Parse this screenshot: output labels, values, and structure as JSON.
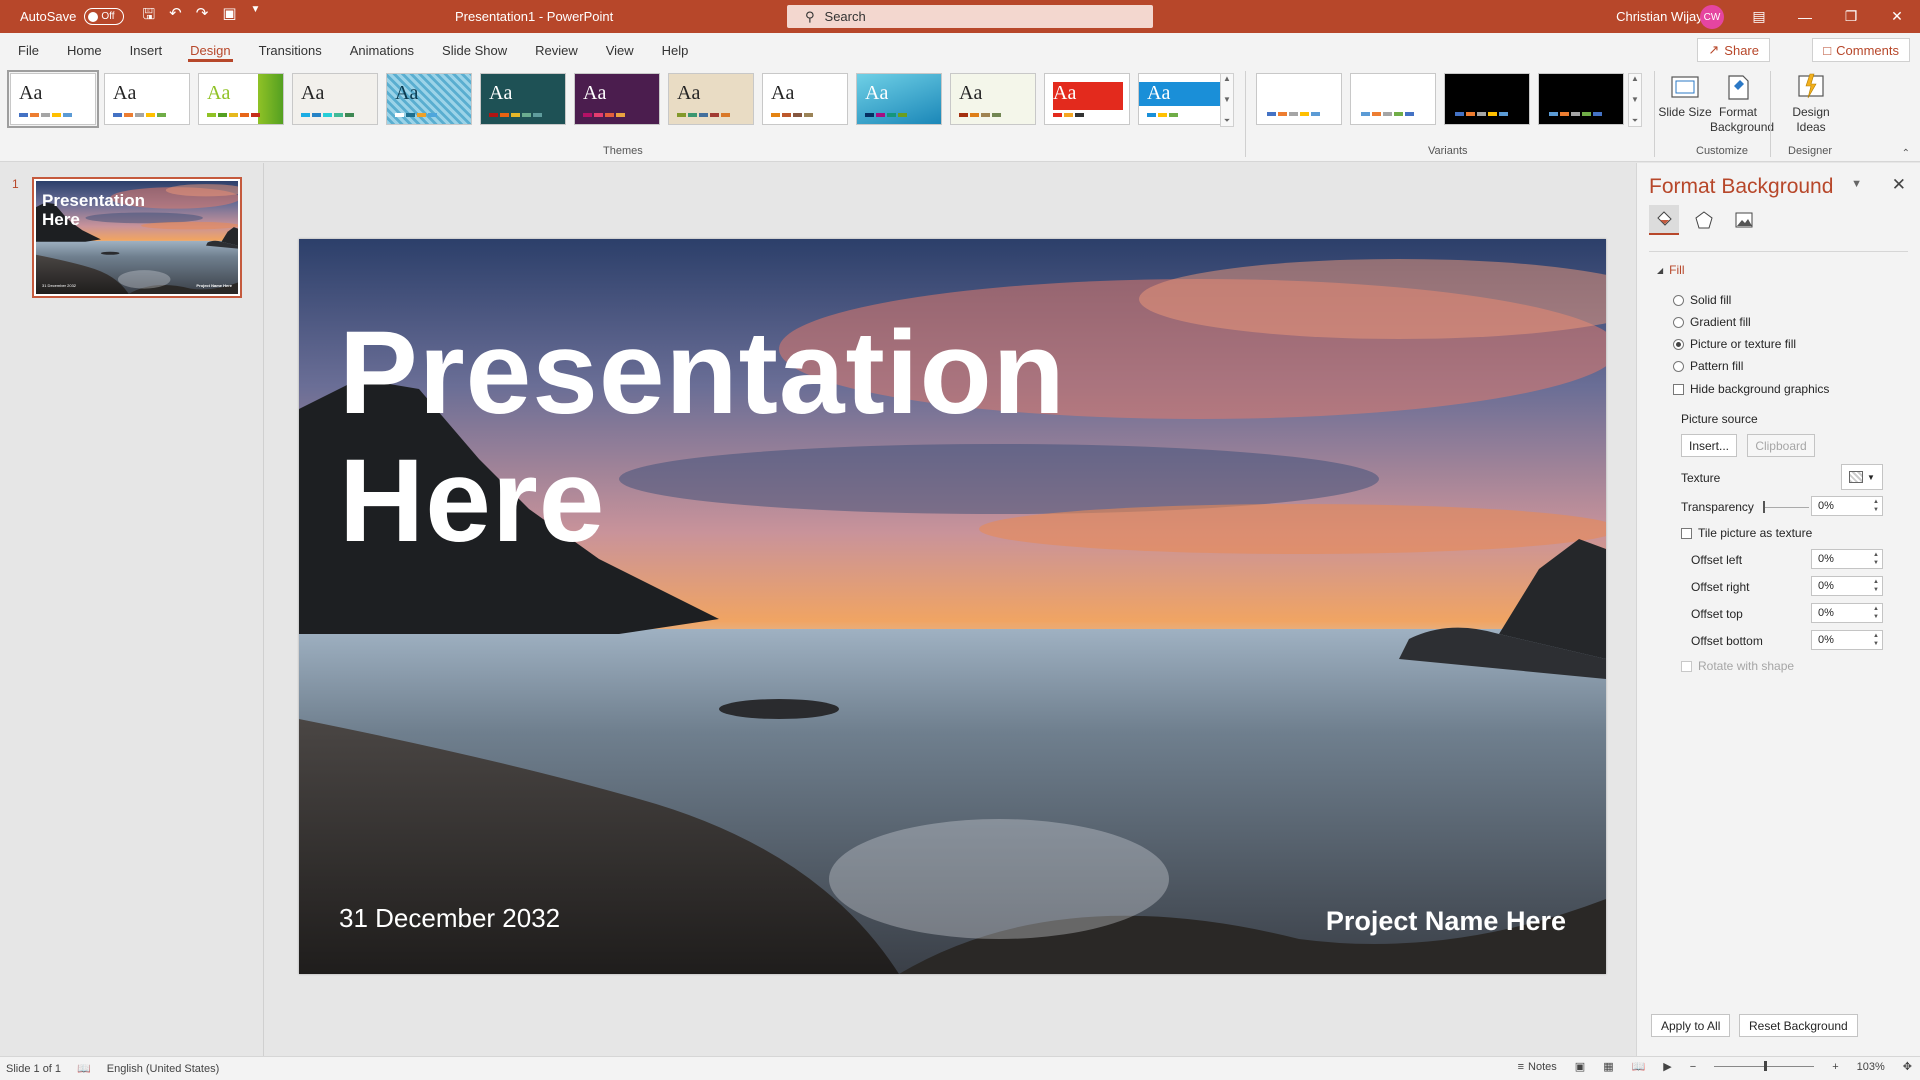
{
  "titlebar": {
    "autosave_label": "AutoSave",
    "autosave_state": "Off",
    "document_title": "Presentation1  -  PowerPoint",
    "search_placeholder": "Search",
    "user_name": "Christian Wijaya",
    "user_initials": "CW"
  },
  "tabs": [
    "File",
    "Home",
    "Insert",
    "Design",
    "Transitions",
    "Animations",
    "Slide Show",
    "Review",
    "View",
    "Help"
  ],
  "active_tab": "Design",
  "share_label": "Share",
  "comments_label": "Comments",
  "ribbon": {
    "themes_label": "Themes",
    "variants_label": "Variants",
    "customize_label": "Customize",
    "designer_label": "Designer",
    "theme_aa": "Aa",
    "slide_size_label": "Slide Size",
    "format_background_label": "Format Background",
    "design_ideas_label": "Design Ideas"
  },
  "thumbnail": {
    "number": "1",
    "title": "Presentation Here",
    "date": "31 December 2032",
    "project": "Project Name Here"
  },
  "slide": {
    "title_line1": "Presentation",
    "title_line2": "Here",
    "date": "31 December 2032",
    "project": "Project Name Here"
  },
  "format_background": {
    "title": "Format Background",
    "fill_section": "Fill",
    "solid_fill": "Solid fill",
    "gradient_fill": "Gradient fill",
    "picture_fill": "Picture or texture fill",
    "pattern_fill": "Pattern fill",
    "hide_graphics": "Hide background graphics",
    "picture_source": "Picture source",
    "insert_btn": "Insert...",
    "clipboard_btn": "Clipboard",
    "texture": "Texture",
    "transparency": "Transparency",
    "transparency_value": "0%",
    "tile_picture": "Tile picture as texture",
    "offset_left": "Offset left",
    "offset_left_value": "0%",
    "offset_right": "Offset right",
    "offset_right_value": "0%",
    "offset_top": "Offset top",
    "offset_top_value": "0%",
    "offset_bottom": "Offset bottom",
    "offset_bottom_value": "0%",
    "rotate_with_shape": "Rotate with shape",
    "apply_all": "Apply to All",
    "reset_background": "Reset Background"
  },
  "statusbar": {
    "slide_info": "Slide 1 of 1",
    "language": "English (United States)",
    "notes": "Notes",
    "zoom": "103%"
  },
  "colors": {
    "accent": "#b7472a",
    "titlebar": "#b7472a"
  }
}
